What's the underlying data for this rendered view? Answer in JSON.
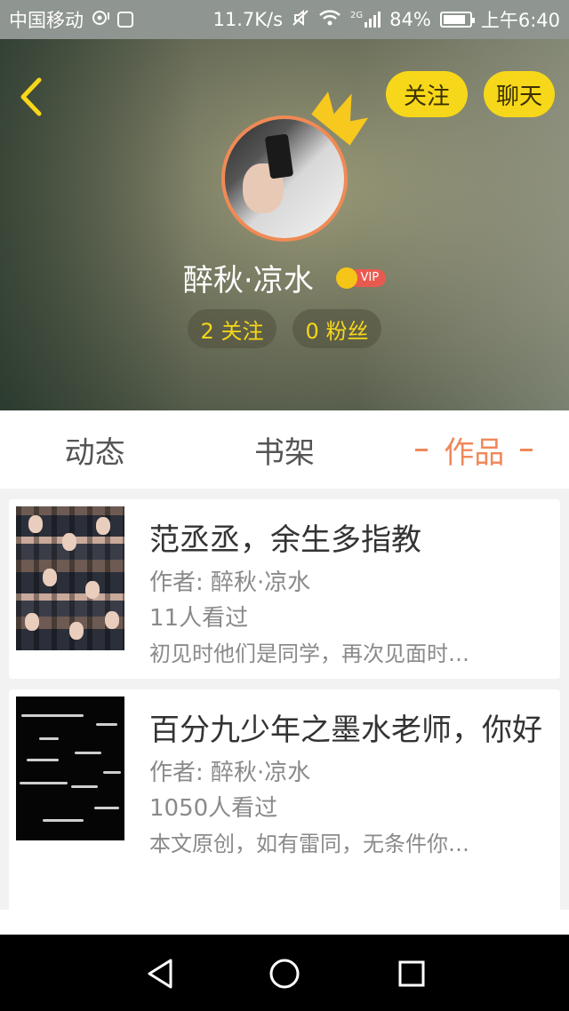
{
  "status_bar": {
    "carrier": "中国移动",
    "speed": "11.7K/s",
    "network_tag": "2G",
    "battery_percent": "84%",
    "battery_level": 0.84,
    "time": "上午6:40"
  },
  "header": {
    "follow_button": "关注",
    "chat_button": "聊天",
    "username": "醉秋·凉水",
    "vip_label": "VIP",
    "following_stat": "2 关注",
    "fans_stat": "0 粉丝"
  },
  "tabs": [
    {
      "label": "动态",
      "active": false
    },
    {
      "label": "书架",
      "active": false
    },
    {
      "label": "作品",
      "active": true
    }
  ],
  "works": [
    {
      "title": "范丞丞，余生多指教",
      "author": "作者: 醉秋·凉水",
      "views": "11人看过",
      "excerpt": "初见时他们是同学，再次见面时…"
    },
    {
      "title": "百分九少年之墨水老师，你好",
      "author": "作者: 醉秋·凉水",
      "views": "1050人看过",
      "excerpt": "本文原创，如有雷同，无条件你…"
    }
  ],
  "colors": {
    "accent_yellow": "#f7d719",
    "active_tab": "#f0885a",
    "avatar_border": "#f08a55",
    "vip_red": "#e85a50"
  },
  "icons": [
    "back-arrow-icon",
    "crown-icon",
    "vip-crown-icon",
    "nav-back-icon",
    "nav-home-icon",
    "nav-recent-icon"
  ]
}
